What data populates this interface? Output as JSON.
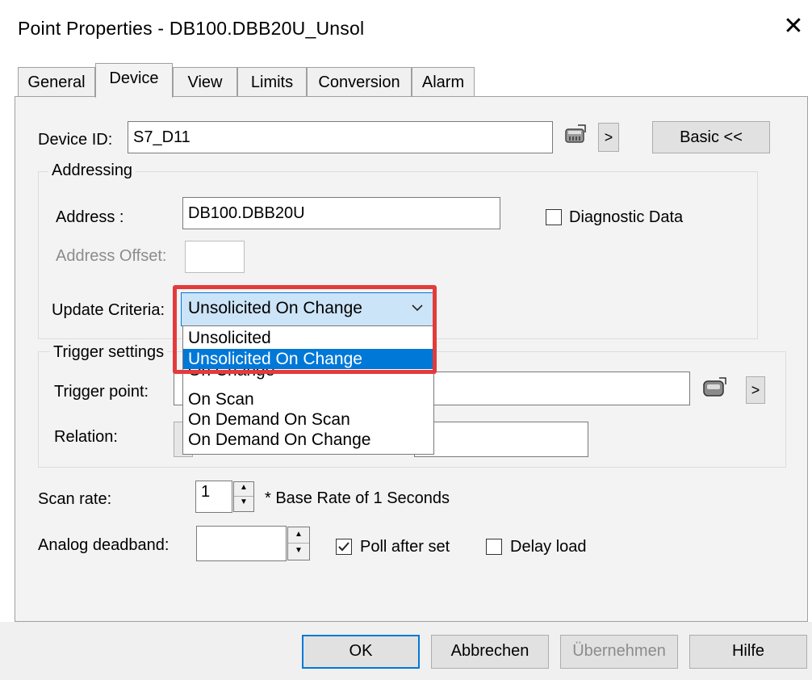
{
  "window": {
    "title": "Point Properties - DB100.DBB20U_Unsol",
    "close_glyph": "✕"
  },
  "tabs": [
    {
      "label": "General"
    },
    {
      "label": "Device",
      "active": true
    },
    {
      "label": "View"
    },
    {
      "label": "Limits"
    },
    {
      "label": "Conversion"
    },
    {
      "label": "Alarm"
    }
  ],
  "device": {
    "label": "Device ID:",
    "value": "S7_D11",
    "browse_icon": "device-browse-icon",
    "arrow_label": ">",
    "basic_label": "Basic <<"
  },
  "addressing": {
    "legend": "Addressing",
    "address_label": "Address :",
    "address_value": "DB100.DBB20U",
    "offset_label": "Address Offset:",
    "offset_value": "",
    "diagnostic_label": "Diagnostic Data",
    "diagnostic_checked": false,
    "update_label": "Update Criteria:",
    "update_value": "Unsolicited On Change"
  },
  "dropdown": {
    "options": [
      "Unsolicited",
      "Unsolicited On Change",
      "On Change",
      "On Scan",
      "On Demand On Scan",
      "On Demand On Change"
    ],
    "selected": "Unsolicited On Change"
  },
  "trigger": {
    "legend": "Trigger settings",
    "point_label": "Trigger point:",
    "point_value": "",
    "arrow_label": ">",
    "relation_label": "Relation:"
  },
  "scan": {
    "label": "Scan rate:",
    "value": "1",
    "note": "* Base Rate of 1 Seconds"
  },
  "deadband": {
    "label": "Analog deadband:",
    "value": "",
    "poll_label": "Poll after set",
    "poll_checked": true,
    "delay_label": "Delay load",
    "delay_checked": false
  },
  "buttons": {
    "ok": "OK",
    "cancel": "Abbrechen",
    "apply": "Übernehmen",
    "help": "Hilfe"
  },
  "colors": {
    "accent": "#0078d7",
    "highlight": "#e33b3b"
  }
}
